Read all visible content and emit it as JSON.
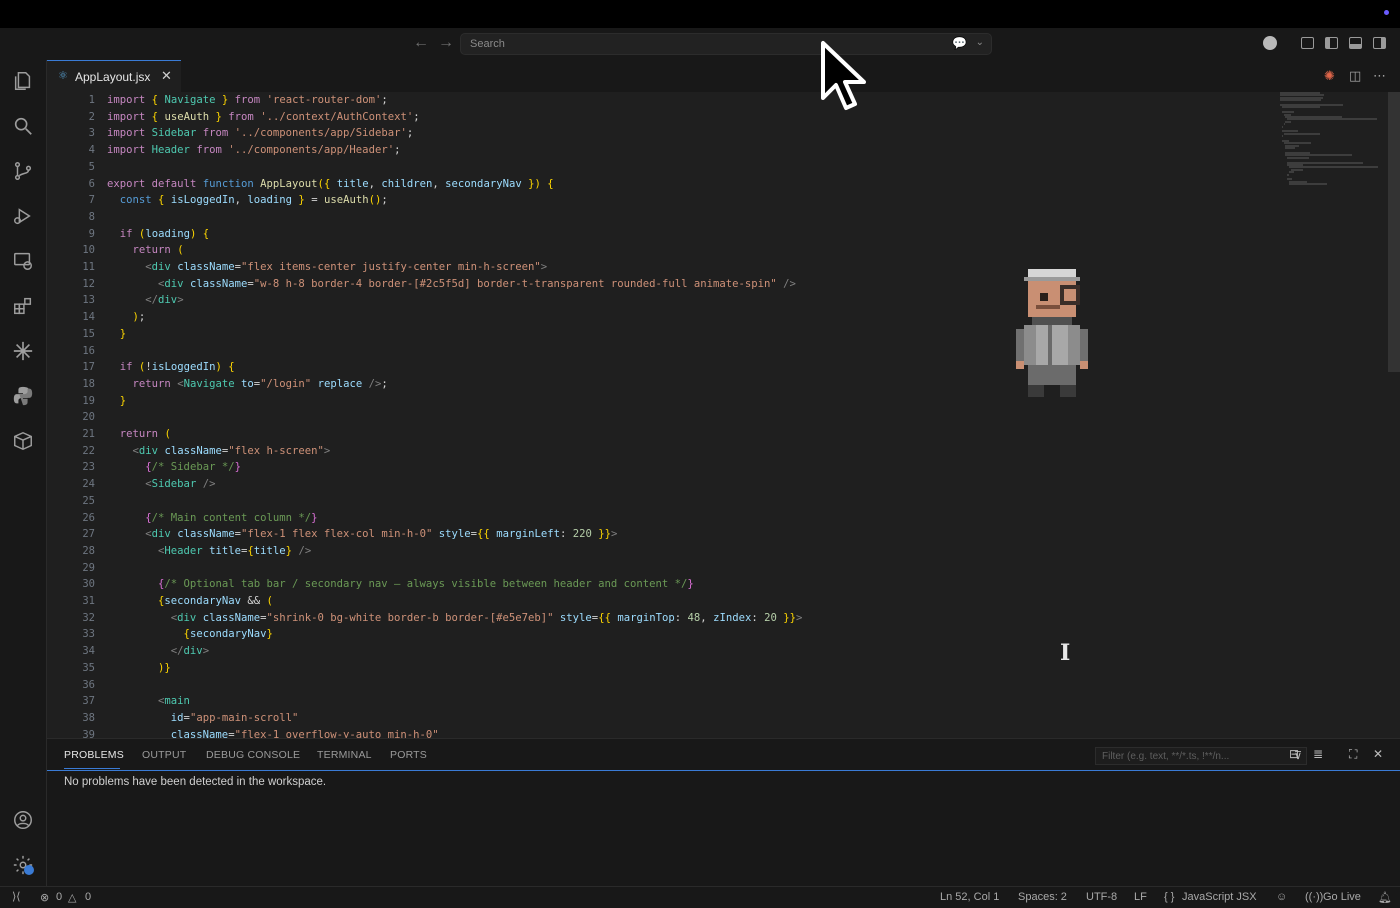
{
  "titlebar": {},
  "command_center": {
    "back_icon": "arrow-left-icon",
    "forward_icon": "arrow-right-icon",
    "search_placeholder": "Search",
    "copilot_icon": "copilot-chat-icon"
  },
  "activity_bar": {
    "items": [
      "explorer-icon",
      "search-icon",
      "source-control-icon",
      "run-debug-icon",
      "remote-explorer-icon",
      "extensions-icon",
      "copilot-icon",
      "python-icon",
      "containers-icon"
    ],
    "bottom": [
      "accounts-icon",
      "manage-gear-icon"
    ]
  },
  "tab": {
    "label": "AppLayout.jsx",
    "close": "✕"
  },
  "editor": {
    "line_numbers": [
      "1",
      "2",
      "3",
      "4",
      "5",
      "6",
      "7",
      "8",
      "9",
      "10",
      "11",
      "12",
      "13",
      "14",
      "15",
      "16",
      "17",
      "18",
      "19",
      "20",
      "21",
      "22",
      "23",
      "24",
      "25",
      "26",
      "27",
      "28",
      "29",
      "30",
      "31",
      "32",
      "33",
      "34",
      "35",
      "36",
      "37",
      "38",
      "39"
    ],
    "lines": [
      "import { Navigate } from 'react-router-dom';",
      "import { useAuth } from '../context/AuthContext';",
      "import Sidebar from '../components/app/Sidebar';",
      "import Header from '../components/app/Header';",
      "",
      "export default function AppLayout({ title, children, secondaryNav }) {",
      "  const { isLoggedIn, loading } = useAuth();",
      "",
      "  if (loading) {",
      "    return (",
      "      <div className=\"flex items-center justify-center min-h-screen\">",
      "        <div className=\"w-8 h-8 border-4 border-[#2c5f5d] border-t-transparent rounded-full animate-spin\" />",
      "      </div>",
      "    );",
      "  }",
      "",
      "  if (!isLoggedIn) {",
      "    return <Navigate to=\"/login\" replace />;",
      "  }",
      "",
      "  return (",
      "    <div className=\"flex h-screen\">",
      "      {/* Sidebar */}",
      "      <Sidebar />",
      "",
      "      {/* Main content column */}",
      "      <div className=\"flex-1 flex flex-col min-h-0\" style={{ marginLeft: 220 }}>",
      "        <Header title={title} />",
      "",
      "        {/* Optional tab bar / secondary nav — always visible between header and content */}",
      "        {secondaryNav && (",
      "          <div className=\"shrink-0 bg-white border-b border-[#e5e7eb]\" style={{ marginTop: 48, zIndex: 20 }}>",
      "            {secondaryNav}",
      "          </div>",
      "        )}",
      "",
      "        <main",
      "          id=\"app-main-scroll\"",
      "          className=\"flex-1 overflow-y-auto min-h-0\""
    ]
  },
  "panel": {
    "tabs": [
      "PROBLEMS",
      "OUTPUT",
      "DEBUG CONSOLE",
      "TERMINAL",
      "PORTS"
    ],
    "filter_placeholder": "Filter (e.g. text, **/*.ts, !**/n...",
    "message": "No problems have been detected in the workspace."
  },
  "statusbar": {
    "errors": "0",
    "warnings": "0",
    "position": "Ln 52, Col 1",
    "spaces": "Spaces: 2",
    "encoding": "UTF-8",
    "eol": "LF",
    "language": "JavaScript JSX",
    "golive": "Go Live"
  },
  "colors": {
    "accent": "#3a7bd5",
    "editor_bg": "#1f1f1f",
    "chrome_bg": "#181818"
  }
}
